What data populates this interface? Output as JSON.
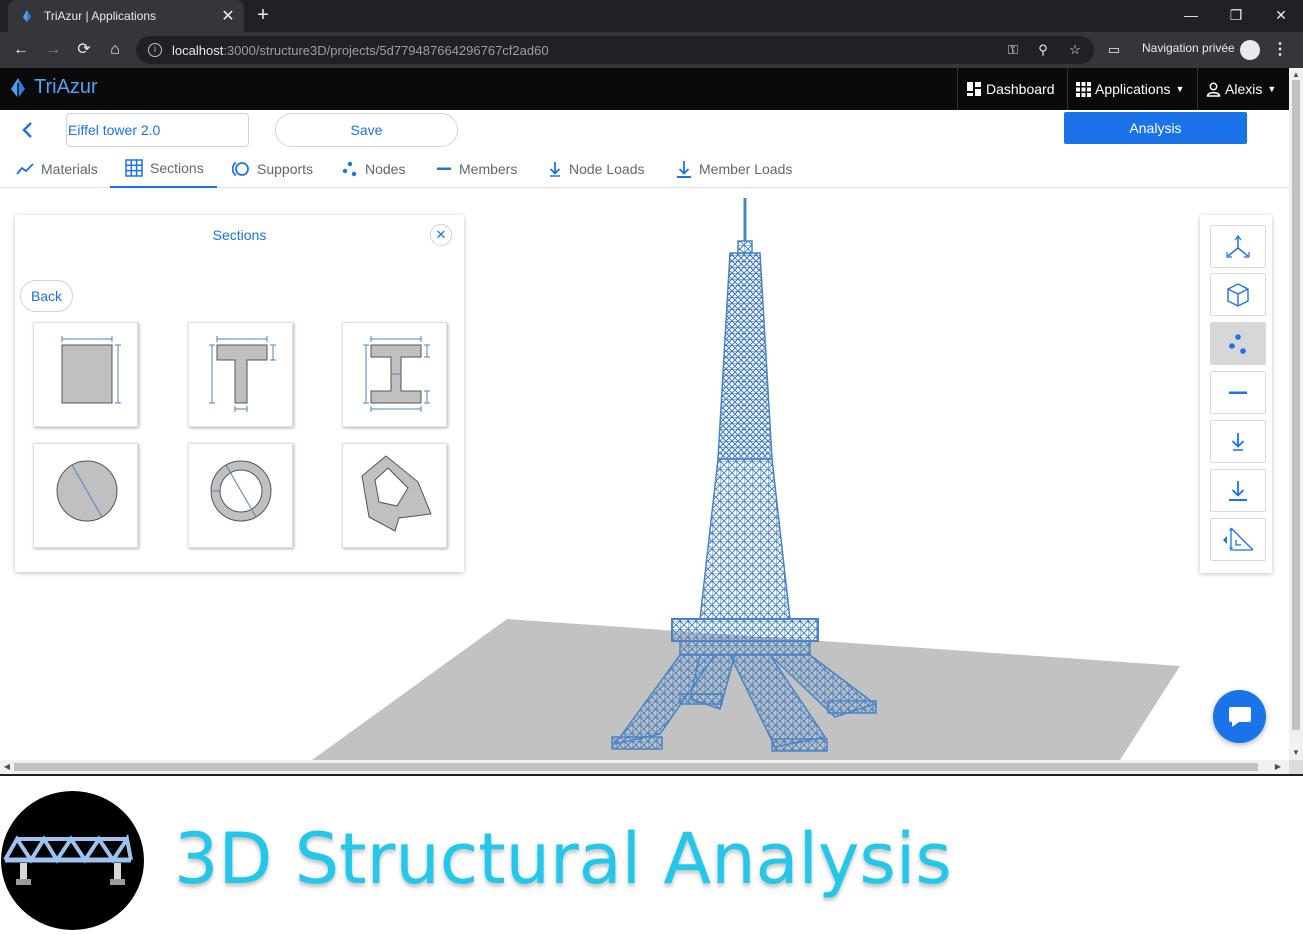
{
  "browser": {
    "tab_title": "TriAzur | Applications",
    "url_host": "localhost",
    "url_path": ":3000/structure3D/projects/5d779487664296767cf2ad60",
    "incognito_label": "Navigation privée"
  },
  "app": {
    "brand": "TriAzur",
    "nav": {
      "dashboard": "Dashboard",
      "applications": "Applications",
      "user": "Alexis"
    }
  },
  "toolbar": {
    "project_name": "Eiffel tower 2.0",
    "save_label": "Save",
    "analysis_label": "Analysis"
  },
  "tabs": [
    {
      "label": "Materials",
      "icon": "chart-line-icon"
    },
    {
      "label": "Sections",
      "icon": "grid-table-icon",
      "active": true
    },
    {
      "label": "Supports",
      "icon": "support-ring-icon"
    },
    {
      "label": "Nodes",
      "icon": "nodes-dots-icon"
    },
    {
      "label": "Members",
      "icon": "dash-line-icon"
    },
    {
      "label": "Node Loads",
      "icon": "arrow-down-load-icon"
    },
    {
      "label": "Member Loads",
      "icon": "arrow-down-bar-icon"
    }
  ],
  "sections_panel": {
    "title": "Sections",
    "back_label": "Back",
    "shapes": [
      "rectangle",
      "t-section",
      "i-section",
      "circle",
      "hollow-circle",
      "polygon"
    ]
  },
  "right_toolbar": {
    "buttons": [
      "axes-icon",
      "cube-view-icon",
      "nodes-icon",
      "member-icon",
      "node-load-icon",
      "member-load-icon",
      "dimension-icon"
    ],
    "active": "nodes-icon"
  },
  "colors": {
    "accent": "#1a73e8",
    "structure": "#4a84c4",
    "ground": "#c0c0c0",
    "footer_title": "#22c7ea"
  },
  "footer": {
    "title": "3D Structural Analysis"
  }
}
